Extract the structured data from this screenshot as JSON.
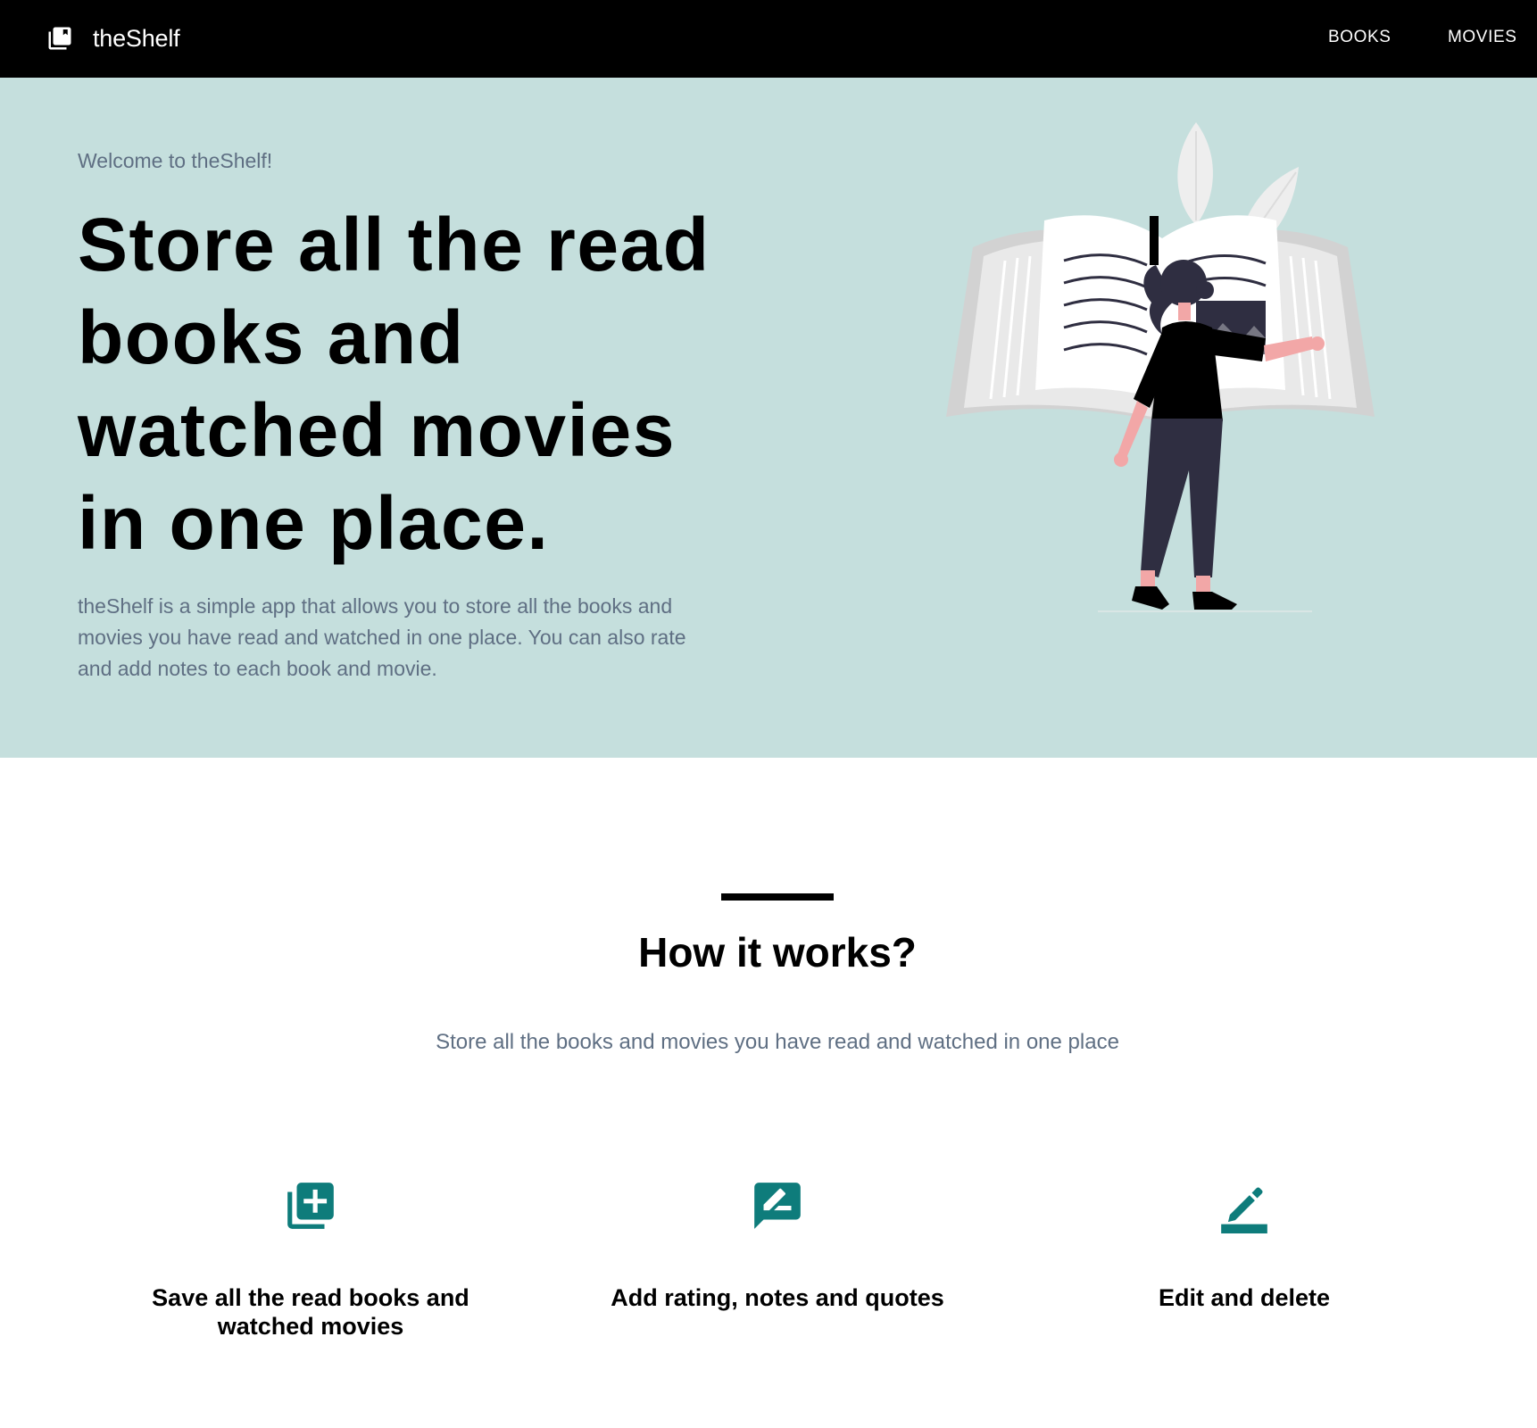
{
  "navbar": {
    "brand_icon": "library-books-icon",
    "brand_name": "theShelf",
    "links": [
      {
        "label": "BOOKS"
      },
      {
        "label": "MOVIES"
      }
    ]
  },
  "hero": {
    "welcome": "Welcome to theShelf!",
    "headline": "Store all the read books and watched movies in one place.",
    "description": "theShelf is a simple app that allows you to store all the books and movies you have read and watched in one place. You can also rate and add notes to each book and movie.",
    "illustration": "woman-reading-giant-book-illustration",
    "background_color": "#c5dfdd"
  },
  "how_it_works": {
    "title": "How it works?",
    "subtitle": "Store all the books and movies you have read and watched in one place",
    "features": [
      {
        "icon": "library-add-icon",
        "label": "Save all the read books and watched movies"
      },
      {
        "icon": "rate-review-icon",
        "label": "Add rating, notes and quotes"
      },
      {
        "icon": "edit-icon",
        "label": "Edit and delete"
      }
    ],
    "accent_color": "#0e7c7b"
  },
  "colors": {
    "navbar_bg": "#000000",
    "muted_text": "#5f6f83"
  }
}
